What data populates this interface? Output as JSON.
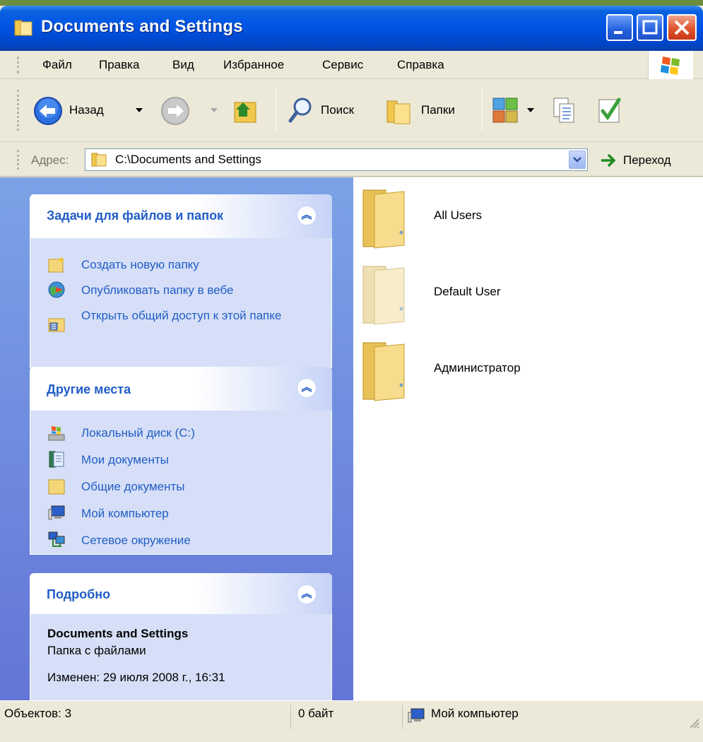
{
  "window": {
    "title": "Documents and Settings"
  },
  "menu": {
    "items": [
      "Файл",
      "Правка",
      "Вид",
      "Избранное",
      "Сервис",
      "Справка"
    ]
  },
  "toolbar": {
    "back_label": "Назад",
    "search_label": "Поиск",
    "folders_label": "Папки"
  },
  "address": {
    "label": "Адрес:",
    "value": "C:\\Documents and Settings",
    "go_label": "Переход"
  },
  "tasks_panel": {
    "title": "Задачи для файлов и папок",
    "items": [
      "Создать новую папку",
      "Опубликовать папку в вебе",
      "Открыть общий доступ к этой папке"
    ]
  },
  "places_panel": {
    "title": "Другие места",
    "items": [
      "Локальный диск (C:)",
      "Мои документы",
      "Общие документы",
      "Мой компьютер",
      "Сетевое окружение"
    ]
  },
  "details_panel": {
    "title": "Подробно",
    "name": "Documents and Settings",
    "type": "Папка с файлами",
    "modified": "Изменен: 29 июля 2008 г., 16:31"
  },
  "files": [
    "All Users",
    "Default User",
    "Администратор"
  ],
  "status": {
    "objects": "Объектов: 3",
    "size": "0 байт",
    "location": "Мой компьютер"
  },
  "colors": {
    "titlebar": "#0055e5",
    "taskpane": "#7ba2e7",
    "task_link": "#215dc6",
    "folder": "#f3d98a"
  }
}
